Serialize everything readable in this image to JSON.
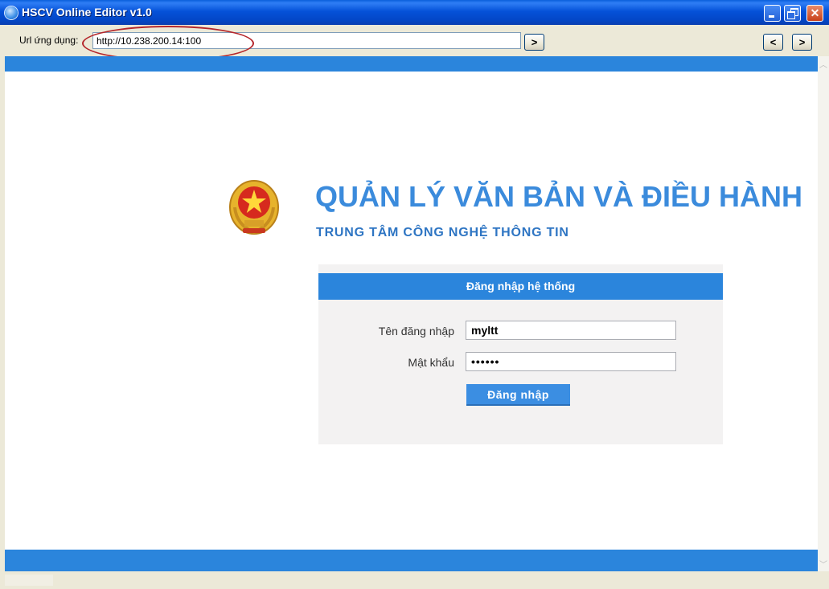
{
  "window": {
    "title": "HSCV Online Editor v1.0"
  },
  "toolbar": {
    "url_label": "Url ứng dụng:",
    "url_value": "http://10.238.200.14:100",
    "go_label": ">",
    "back_label": "<",
    "forward_label": ">"
  },
  "header": {
    "title": "QUẢN LÝ VĂN BẢN VÀ ĐIỀU HÀNH",
    "subtitle": "TRUNG TÂM CÔNG NGHỆ THÔNG TIN"
  },
  "login": {
    "panel_title": "Đăng nhập hệ thống",
    "username_label": "Tên đăng nhập",
    "username_value": "myltt",
    "password_label": "Mật khẩu",
    "password_value": "••••••",
    "submit_label": "Đăng nhập"
  },
  "colors": {
    "brand_blue": "#2b85dc",
    "title_blue": "#3b8bdc",
    "annotation_red": "#b5262b"
  },
  "icons": [
    "app-icon",
    "minimize-icon",
    "maximize-icon",
    "close-icon",
    "national-emblem-icon"
  ]
}
